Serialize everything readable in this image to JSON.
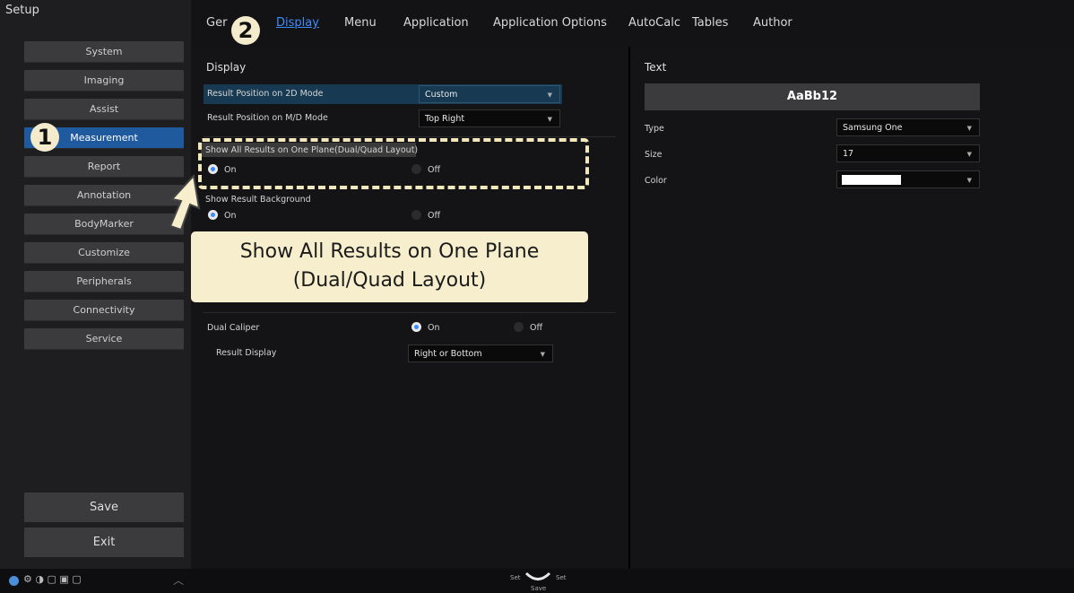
{
  "sidebar": {
    "title": "Setup",
    "items": [
      {
        "label": "System",
        "active": false
      },
      {
        "label": "Imaging",
        "active": false
      },
      {
        "label": "Assist",
        "active": false
      },
      {
        "label": "Measurement",
        "active": true
      },
      {
        "label": "Report",
        "active": false
      },
      {
        "label": "Annotation",
        "active": false
      },
      {
        "label": "BodyMarker",
        "active": false
      },
      {
        "label": "Customize",
        "active": false
      },
      {
        "label": "Peripherals",
        "active": false
      },
      {
        "label": "Connectivity",
        "active": false
      },
      {
        "label": "Service",
        "active": false
      }
    ],
    "save": "Save",
    "exit": "Exit"
  },
  "tabs": [
    {
      "label": "Ger"
    },
    {
      "label": "Display",
      "active": true
    },
    {
      "label": "Menu"
    },
    {
      "label": "Application"
    },
    {
      "label": "Application Options"
    },
    {
      "label": "AutoCalc"
    },
    {
      "label": "Tables"
    },
    {
      "label": "Author"
    }
  ],
  "display": {
    "title": "Display",
    "result_2d_label": "Result Position on 2D Mode",
    "result_2d_value": "Custom",
    "result_md_label": "Result Position on M/D Mode",
    "result_md_value": "Top Right",
    "show_all_label": "Show All Results on One Plane(Dual/Quad Layout)",
    "on": "On",
    "off": "Off",
    "show_bg_label": "Show Result Background",
    "dual_caliper_label": "Dual Caliper",
    "result_display_label": "Result Display",
    "result_display_value": "Right or Bottom"
  },
  "text_panel": {
    "title": "Text",
    "preview": "AaBb12",
    "type_label": "Type",
    "type_value": "Samsung One",
    "size_label": "Size",
    "size_value": "17",
    "color_label": "Color",
    "color_value": "#ffffff"
  },
  "overlay": {
    "badge1": "1",
    "badge2": "2",
    "callout_line1": "Show All Results on One Plane",
    "callout_line2": "(Dual/Quad Layout)"
  },
  "footer": {
    "set_left": "Set",
    "set_right": "Set",
    "save": "Save"
  },
  "colors": {
    "accent": "#3c8dff",
    "active_sidebar": "#1f5a9e",
    "callout_bg": "#f6eecd"
  }
}
